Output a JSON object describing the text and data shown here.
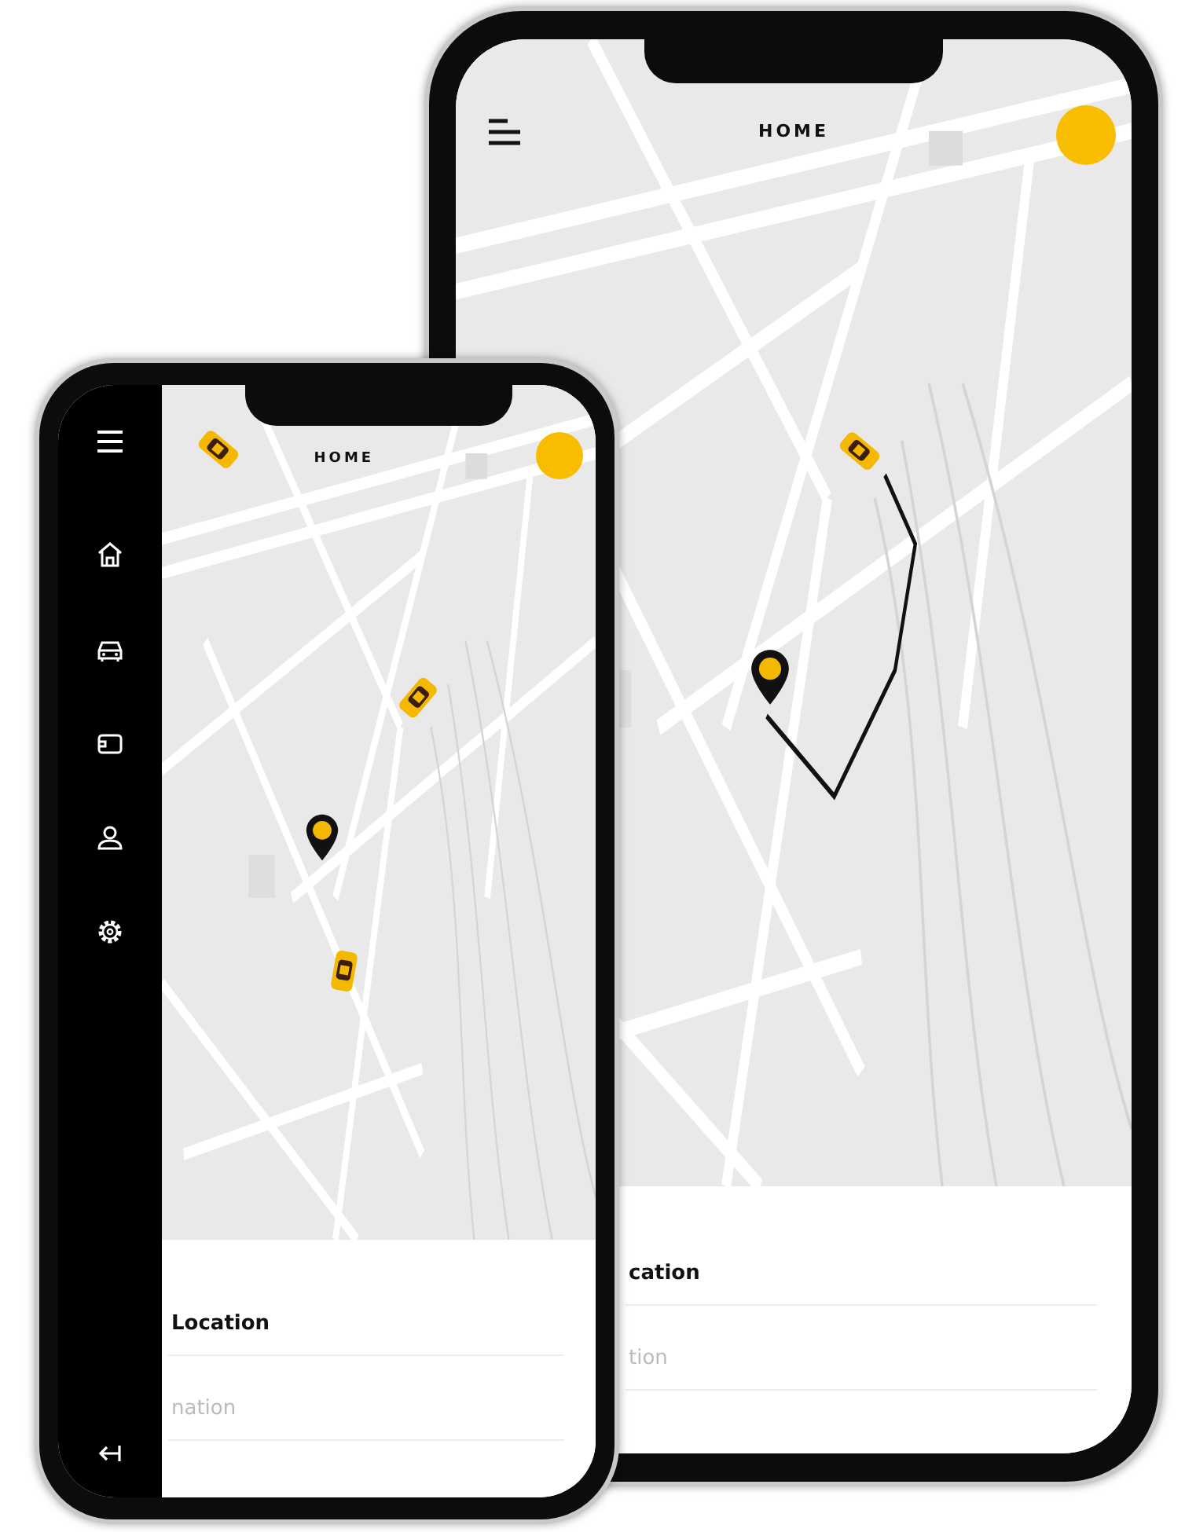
{
  "phones": [
    {
      "title": "HOME",
      "menu_open": false,
      "location_field": {
        "value": "cation"
      },
      "destination_field": {
        "placeholder": "tion"
      }
    },
    {
      "title": "HOME",
      "menu_open": true,
      "location_field": {
        "value": "Location"
      },
      "destination_field": {
        "placeholder": "nation"
      }
    }
  ]
}
